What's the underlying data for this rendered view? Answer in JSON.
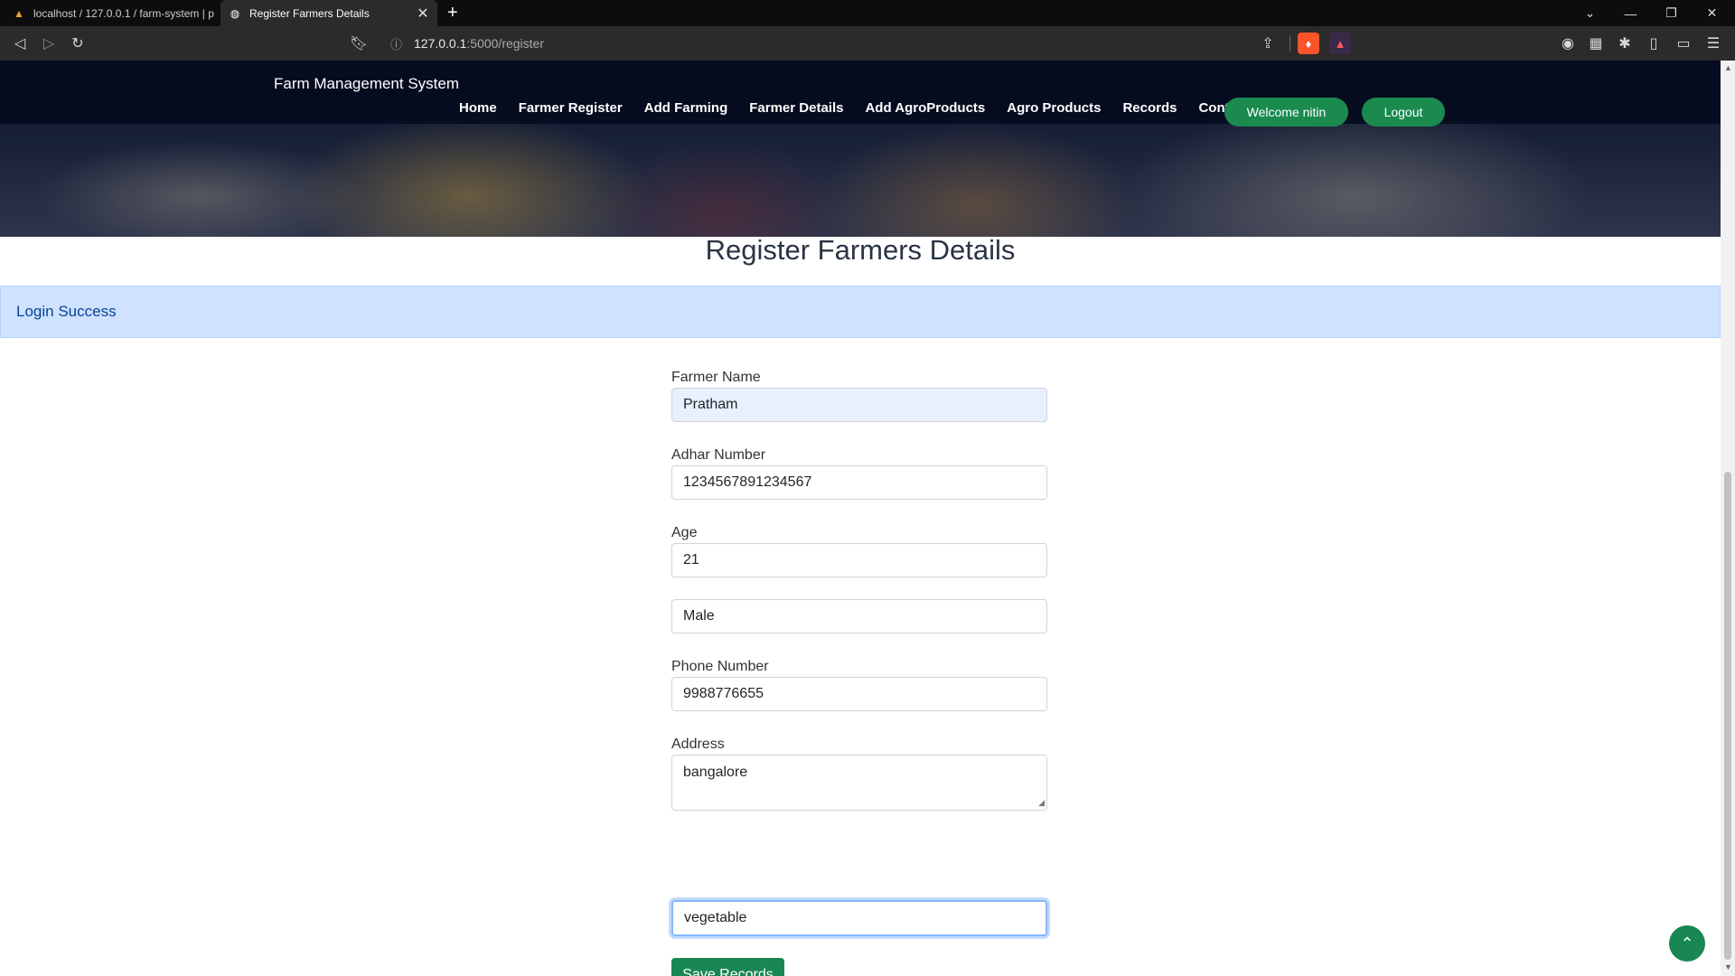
{
  "browser": {
    "tabs": [
      {
        "title": "localhost / 127.0.0.1 / farm-system | p"
      },
      {
        "title": "Register Farmers Details"
      }
    ],
    "url_host": "127.0.0.1",
    "url_rest": ":5000/register"
  },
  "nav": {
    "brand": "Farm Management System",
    "links": [
      "Home",
      "Farmer Register",
      "Add Farming",
      "Farmer Details",
      "Add AgroProducts",
      "Agro Products",
      "Records",
      "Contact"
    ],
    "welcome": "Welcome nitin",
    "logout": "Logout"
  },
  "page": {
    "title": "Register Farmers Details",
    "alert": "Login Success"
  },
  "form": {
    "farmer_name_label": "Farmer Name",
    "farmer_name": "Pratham",
    "adhar_label": "Adhar Number",
    "adhar": "1234567891234567",
    "age_label": "Age",
    "age": "21",
    "gender": "Male",
    "phone_label": "Phone Number",
    "phone": "9988776655",
    "address_label": "Address",
    "address": "bangalore",
    "farming": "vegetable",
    "save_label": "Save Records"
  },
  "colors": {
    "accent": "#198754",
    "navbar": "#060c20",
    "alert_bg": "#cfe2ff"
  },
  "icons": {
    "back": "arrow-left-icon",
    "forward": "arrow-right-icon",
    "reload": "reload-icon",
    "to_top": "chevron-up-icon"
  }
}
